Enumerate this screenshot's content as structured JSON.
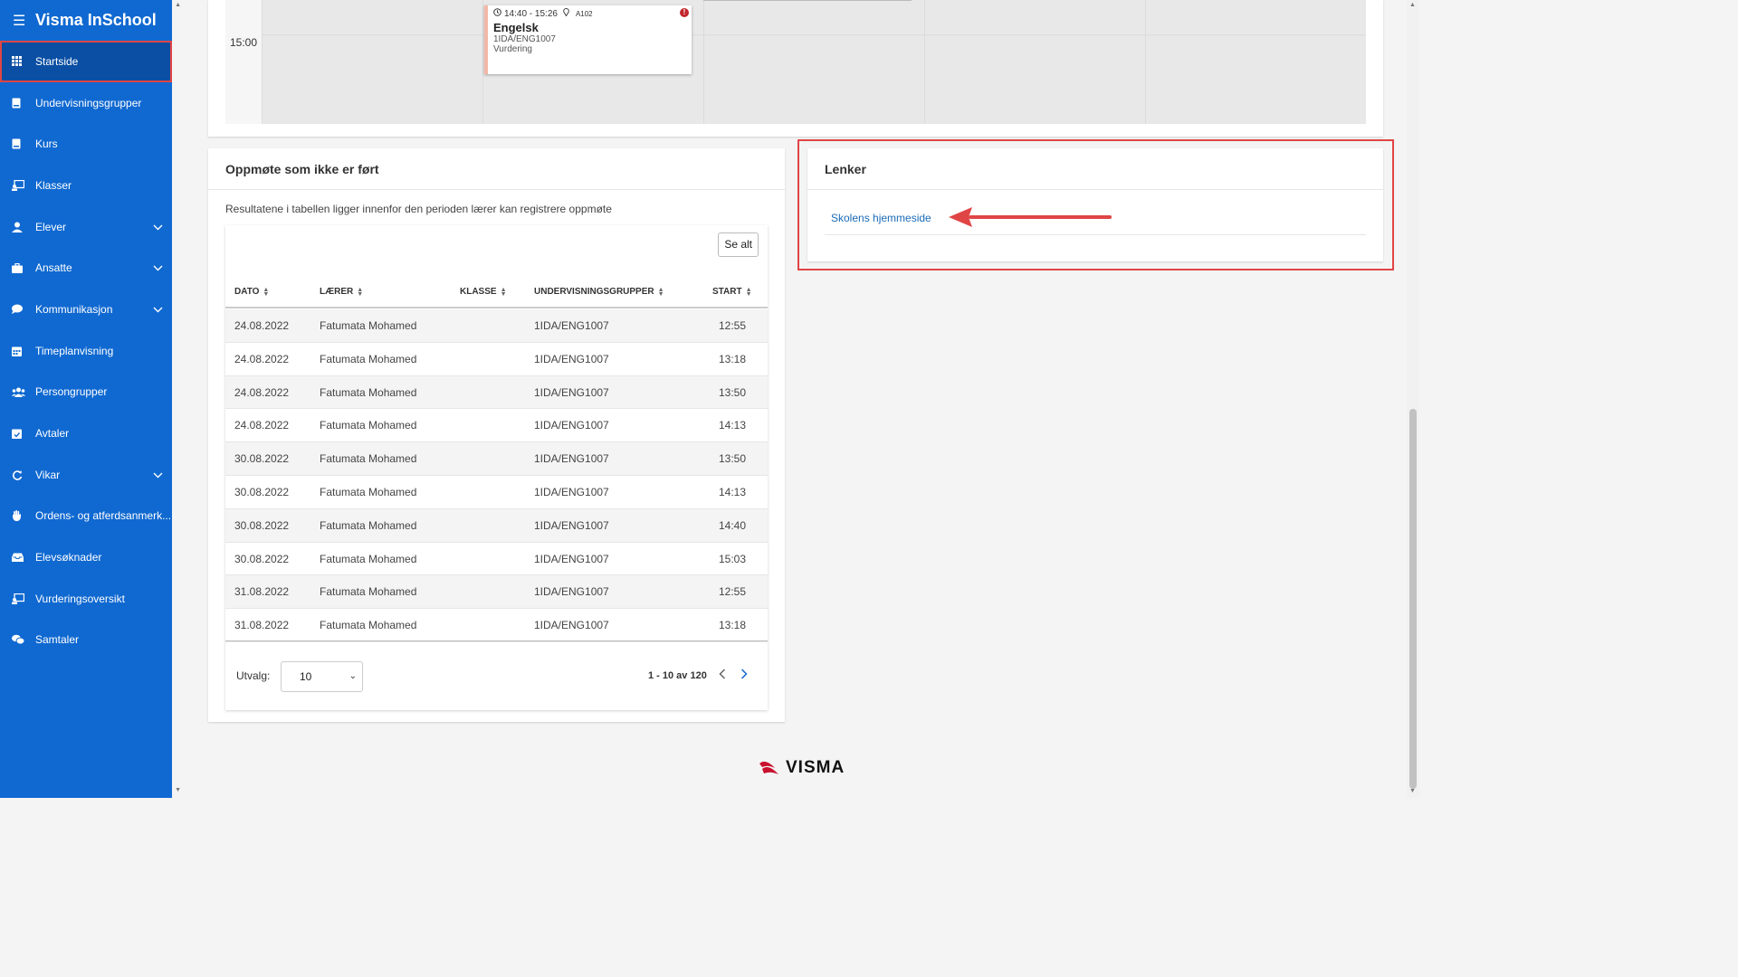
{
  "app": {
    "title": "Visma InSchool"
  },
  "sidebar": {
    "items": [
      {
        "label": "Startside",
        "icon": "grid-icon",
        "active": true
      },
      {
        "label": "Undervisningsgrupper",
        "icon": "book-icon"
      },
      {
        "label": "Kurs",
        "icon": "book-icon"
      },
      {
        "label": "Klasser",
        "icon": "classroom-icon"
      },
      {
        "label": "Elever",
        "icon": "student-icon",
        "expandable": true
      },
      {
        "label": "Ansatte",
        "icon": "briefcase-icon",
        "expandable": true
      },
      {
        "label": "Kommunikasjon",
        "icon": "chat-icon",
        "expandable": true
      },
      {
        "label": "Timeplanvisning",
        "icon": "calendar-icon"
      },
      {
        "label": "Persongrupper",
        "icon": "people-icon"
      },
      {
        "label": "Avtaler",
        "icon": "calendar-check-icon"
      },
      {
        "label": "Vikar",
        "icon": "refresh-icon",
        "expandable": true
      },
      {
        "label": "Ordens- og atferdsanmerk...",
        "icon": "hand-icon"
      },
      {
        "label": "Elevsøknader",
        "icon": "inbox-icon"
      },
      {
        "label": "Vurderingsoversikt",
        "icon": "assessment-icon"
      },
      {
        "label": "Samtaler",
        "icon": "conversation-icon"
      }
    ]
  },
  "calendar": {
    "time_label": "15:00",
    "event": {
      "time": "14:40 - 15:26",
      "room": "A102",
      "subject": "Engelsk",
      "code": "1IDA/ENG1007",
      "type": "Vurdering",
      "warning": "!"
    }
  },
  "attendance": {
    "title": "Oppmøte som ikke er ført",
    "description": "Resultatene i tabellen ligger innenfor den perioden lærer kan registrere oppmøte",
    "see_all": "Se alt",
    "columns": [
      "DATO",
      "LÆRER",
      "KLASSE",
      "UNDERVISNINGSGRUPPER",
      "START"
    ],
    "rows": [
      [
        "24.08.2022",
        "Fatumata Mohamed",
        "",
        "1IDA/ENG1007",
        "12:55"
      ],
      [
        "24.08.2022",
        "Fatumata Mohamed",
        "",
        "1IDA/ENG1007",
        "13:18"
      ],
      [
        "24.08.2022",
        "Fatumata Mohamed",
        "",
        "1IDA/ENG1007",
        "13:50"
      ],
      [
        "24.08.2022",
        "Fatumata Mohamed",
        "",
        "1IDA/ENG1007",
        "14:13"
      ],
      [
        "30.08.2022",
        "Fatumata Mohamed",
        "",
        "1IDA/ENG1007",
        "13:50"
      ],
      [
        "30.08.2022",
        "Fatumata Mohamed",
        "",
        "1IDA/ENG1007",
        "14:13"
      ],
      [
        "30.08.2022",
        "Fatumata Mohamed",
        "",
        "1IDA/ENG1007",
        "14:40"
      ],
      [
        "30.08.2022",
        "Fatumata Mohamed",
        "",
        "1IDA/ENG1007",
        "15:03"
      ],
      [
        "31.08.2022",
        "Fatumata Mohamed",
        "",
        "1IDA/ENG1007",
        "12:55"
      ],
      [
        "31.08.2022",
        "Fatumata Mohamed",
        "",
        "1IDA/ENG1007",
        "13:18"
      ]
    ],
    "footer": {
      "utvalg_label": "Utvalg:",
      "page_size": "10",
      "range_text": "1 - 10 av 120"
    }
  },
  "links": {
    "title": "Lenker",
    "items": [
      {
        "label": "Skolens hjemmeside"
      }
    ]
  },
  "footer": {
    "logo_text": "VISMA"
  },
  "colors": {
    "sidebar_bg": "#1069d1",
    "annotation_red": "#e04545",
    "link_blue": "#1a6bb8"
  }
}
